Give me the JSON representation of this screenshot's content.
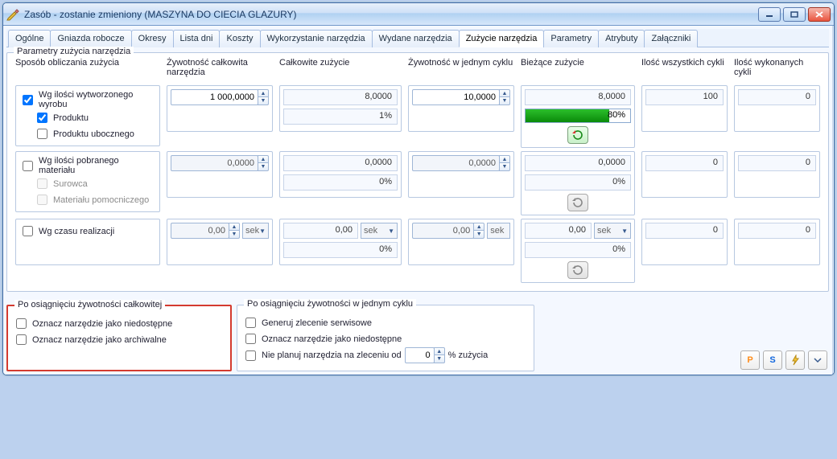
{
  "window": {
    "title": "Zasób - zostanie zmieniony  (MASZYNA DO CIECIA GLAZURY)"
  },
  "tabs": [
    {
      "label": "Ogólne"
    },
    {
      "label": "Gniazda robocze"
    },
    {
      "label": "Okresy"
    },
    {
      "label": "Lista dni"
    },
    {
      "label": "Koszty"
    },
    {
      "label": "Wykorzystanie narzędzia"
    },
    {
      "label": "Wydane narzędzia"
    },
    {
      "label": "Zużycie narzędzia",
      "active": true
    },
    {
      "label": "Parametry"
    },
    {
      "label": "Atrybuty"
    },
    {
      "label": "Załączniki"
    }
  ],
  "group_title": "Parametry zużycia narzędzia",
  "columns": {
    "method": "Sposób obliczania zużycia",
    "total_life": "Żywotność całkowita narzędzia",
    "total_usage": "Całkowite zużycie",
    "cycle_life": "Żywotność w jednym cyklu",
    "current_usage": "Bieżące zużycie",
    "total_cycles": "Ilość wszystkich cykli",
    "done_cycles": "Ilość wykonanych cykli"
  },
  "rows": [
    {
      "method_main": "Wg ilości wytworzonego wyrobu",
      "method_main_checked": true,
      "subs": [
        {
          "label": "Produktu",
          "checked": true
        },
        {
          "label": "Produktu ubocznego",
          "checked": false
        }
      ],
      "total_life": "1 000,0000",
      "total_usage": "8,0000",
      "total_usage_pct": "1%",
      "cycle_life": "10,0000",
      "current_usage": "8,0000",
      "current_usage_pct": "80%",
      "progress_pct": 80,
      "total_cycles": "100",
      "done_cycles": "0",
      "reset_enabled": true
    },
    {
      "method_main": "Wg ilości pobranego materiału",
      "method_main_checked": false,
      "subs": [
        {
          "label": "Surowca",
          "checked": false,
          "disabled": true
        },
        {
          "label": "Materiału pomocniczego",
          "checked": false,
          "disabled": true
        }
      ],
      "total_life": "0,0000",
      "total_usage": "0,0000",
      "total_usage_pct": "0%",
      "cycle_life": "0,0000",
      "current_usage": "0,0000",
      "current_usage_pct": "0%",
      "total_cycles": "0",
      "done_cycles": "0",
      "reset_enabled": false
    },
    {
      "method_main": "Wg czasu realizacji",
      "method_main_checked": false,
      "subs": [],
      "time_mode": true,
      "total_life": "0,00",
      "total_life_unit": "sek",
      "total_usage": "0,00",
      "total_usage_unit": "sek",
      "total_usage_pct": "0%",
      "cycle_life": "0,00",
      "cycle_life_unit": "sek",
      "current_usage": "0,00",
      "current_usage_unit": "sek",
      "current_usage_pct": "0%",
      "total_cycles": "0",
      "done_cycles": "0",
      "reset_enabled": false
    }
  ],
  "total_life_box": {
    "title": "Po osiągnięciu żywotności całkowitej",
    "opt1": "Oznacz narzędzie jako niedostępne",
    "opt2": "Oznacz narzędzie jako archiwalne"
  },
  "cycle_life_box": {
    "title": "Po osiągnięciu żywotności w jednym cyklu",
    "opt1": "Generuj zlecenie serwisowe",
    "opt2": "Oznacz narzędzie jako niedostępne",
    "opt3_prefix": "Nie planuj narzędzia na zleceniu od",
    "opt3_value": "0",
    "opt3_suffix": "% zużycia"
  }
}
